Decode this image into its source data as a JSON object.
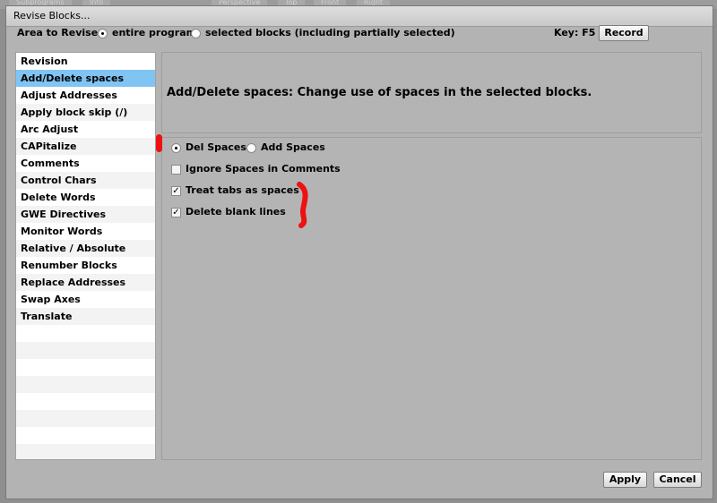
{
  "background_tabs": [
    "Subprograms",
    "Info",
    "Perspective",
    "Top",
    "Front",
    "Right"
  ],
  "dialog": {
    "title": "Revise Blocks..."
  },
  "area": {
    "label": "Area to Revise:",
    "option_entire": "entire program",
    "option_selected": "selected blocks (including partially selected)",
    "selected": "entire program",
    "key_label": "Key: F5",
    "record_button": "Record"
  },
  "sidebar": {
    "items": [
      {
        "label": "Revision"
      },
      {
        "label": "Add/Delete spaces"
      },
      {
        "label": "Adjust Addresses"
      },
      {
        "label": "Apply block skip (/)"
      },
      {
        "label": "Arc Adjust"
      },
      {
        "label": "CAPitalize"
      },
      {
        "label": "Comments"
      },
      {
        "label": "Control Chars"
      },
      {
        "label": "Delete Words"
      },
      {
        "label": "GWE Directives"
      },
      {
        "label": "Monitor Words"
      },
      {
        "label": "Relative / Absolute"
      },
      {
        "label": "Renumber Blocks"
      },
      {
        "label": "Replace Addresses"
      },
      {
        "label": "Swap Axes"
      },
      {
        "label": "Translate"
      }
    ],
    "selected": "Add/Delete spaces"
  },
  "description": "Add/Delete spaces: Change use of spaces in the selected blocks.",
  "options": {
    "del_spaces": "Del Spaces",
    "add_spaces": "Add Spaces",
    "mode_selected": "Del Spaces",
    "ignore_comments": {
      "label": "Ignore Spaces in Comments",
      "checked": false
    },
    "treat_tabs": {
      "label": "Treat tabs as spaces",
      "checked": true
    },
    "delete_blank": {
      "label": "Delete blank lines",
      "checked": true
    }
  },
  "footer": {
    "apply": "Apply",
    "cancel": "Cancel"
  },
  "colors": {
    "selection": "#80c4f4",
    "annotation": "#ee1111"
  }
}
